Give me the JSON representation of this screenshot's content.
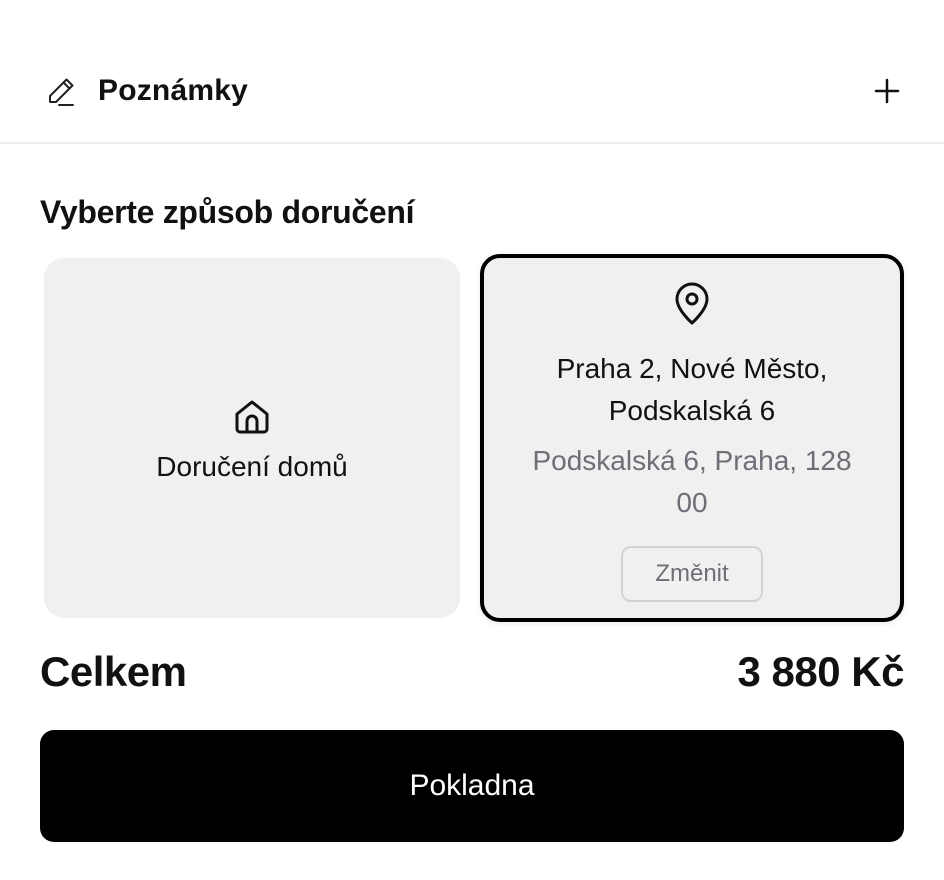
{
  "notes": {
    "label": "Poznámky",
    "edit_icon": "pencil-icon",
    "add_icon": "plus-icon"
  },
  "delivery": {
    "title": "Vyberte způsob doručení",
    "home": {
      "icon": "home-icon",
      "label": "Doručení domů"
    },
    "pickup": {
      "icon": "map-pin-icon",
      "name": "Praha 2, Nové Město, Podskalská 6",
      "address": "Podskalská 6, Praha, 128 00",
      "change_label": "Změnit",
      "selected": true
    }
  },
  "total": {
    "label": "Celkem",
    "value": "3 880 Kč"
  },
  "checkout": {
    "label": "Pokladna"
  },
  "colors": {
    "card_bg": "#f0f0f0",
    "selected_border": "#000000",
    "muted_text": "#6e6e76",
    "checkout_bg": "#000000"
  }
}
